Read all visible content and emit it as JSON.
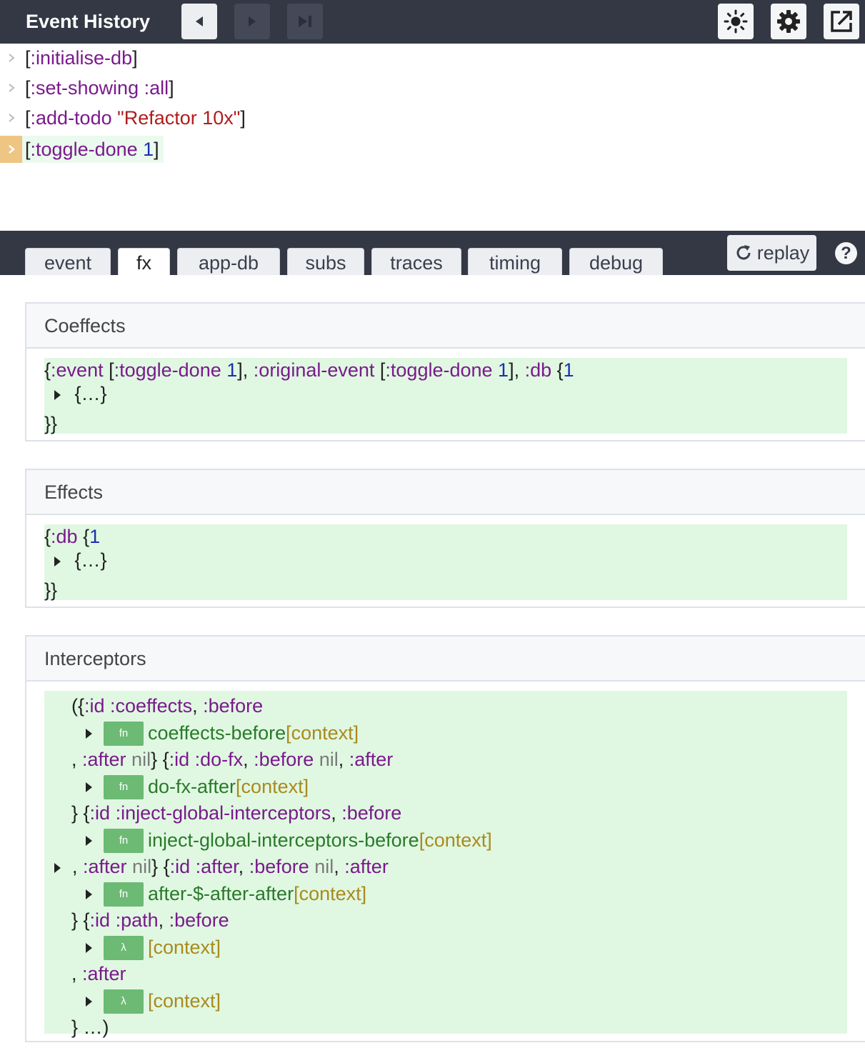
{
  "header": {
    "title": "Event History"
  },
  "events": [
    {
      "parts": [
        {
          "t": "[",
          "c": "p"
        },
        {
          "t": ":initialise-db",
          "c": "kw"
        },
        {
          "t": "]",
          "c": "p"
        }
      ],
      "selected": false
    },
    {
      "parts": [
        {
          "t": "[",
          "c": "p"
        },
        {
          "t": ":set-showing :all",
          "c": "kw"
        },
        {
          "t": "]",
          "c": "p"
        }
      ],
      "selected": false
    },
    {
      "parts": [
        {
          "t": "[",
          "c": "p"
        },
        {
          "t": ":add-todo ",
          "c": "kw"
        },
        {
          "t": "\"Refactor 10x\"",
          "c": "str"
        },
        {
          "t": "]",
          "c": "p"
        }
      ],
      "selected": false
    },
    {
      "parts": [
        {
          "t": "[",
          "c": "p"
        },
        {
          "t": ":toggle-done ",
          "c": "kw"
        },
        {
          "t": "1",
          "c": "num"
        },
        {
          "t": "]",
          "c": "p"
        }
      ],
      "selected": true
    }
  ],
  "tabs": [
    {
      "label": "event",
      "active": false
    },
    {
      "label": "fx",
      "active": true
    },
    {
      "label": "app-db",
      "active": false
    },
    {
      "label": "subs",
      "active": false
    },
    {
      "label": "traces",
      "active": false
    },
    {
      "label": "timing",
      "active": false
    },
    {
      "label": "debug",
      "active": false
    }
  ],
  "replay_label": "replay",
  "help_label": "?",
  "coeffects": {
    "title": "Coeffects",
    "line1": [
      {
        "t": "{",
        "c": "p"
      },
      {
        "t": ":event",
        "c": "kw"
      },
      {
        "t": " [",
        "c": "p"
      },
      {
        "t": ":toggle-done",
        "c": "kw"
      },
      {
        "t": " ",
        "c": "p"
      },
      {
        "t": "1",
        "c": "num"
      },
      {
        "t": "], ",
        "c": "p"
      },
      {
        "t": ":original-event",
        "c": "kw"
      },
      {
        "t": " [",
        "c": "p"
      },
      {
        "t": ":toggle-done",
        "c": "kw"
      },
      {
        "t": " ",
        "c": "p"
      },
      {
        "t": "1",
        "c": "num"
      },
      {
        "t": "], ",
        "c": "p"
      },
      {
        "t": ":db",
        "c": "kw"
      },
      {
        "t": " {",
        "c": "p"
      },
      {
        "t": "1",
        "c": "num"
      }
    ],
    "collapsed": "{…}",
    "closing": "}}"
  },
  "effects": {
    "title": "Effects",
    "line1": [
      {
        "t": "{",
        "c": "p"
      },
      {
        "t": ":db",
        "c": "kw"
      },
      {
        "t": " {",
        "c": "p"
      },
      {
        "t": "1",
        "c": "num"
      }
    ],
    "collapsed": "{…}",
    "closing": "}}"
  },
  "interceptors": {
    "title": "Interceptors",
    "rows": [
      {
        "tri": false,
        "parts": [
          {
            "t": "({",
            "c": "p"
          },
          {
            "t": ":id :coeffects",
            "c": "kw"
          },
          {
            "t": ", ",
            "c": "p"
          },
          {
            "t": ":before",
            "c": "kw"
          }
        ]
      },
      {
        "fn": "fn",
        "name": "coeffects-before",
        "ctx": "[context]"
      },
      {
        "tri": false,
        "parts": [
          {
            "t": ", ",
            "c": "p"
          },
          {
            "t": ":after",
            "c": "kw"
          },
          {
            "t": " nil",
            "c": "nil"
          },
          {
            "t": "} {",
            "c": "p"
          },
          {
            "t": ":id :do-fx",
            "c": "kw"
          },
          {
            "t": ", ",
            "c": "p"
          },
          {
            "t": ":before",
            "c": "kw"
          },
          {
            "t": " nil",
            "c": "nil"
          },
          {
            "t": ", ",
            "c": "p"
          },
          {
            "t": ":after",
            "c": "kw"
          }
        ]
      },
      {
        "fn": "fn",
        "name": "do-fx-after",
        "ctx": "[context]"
      },
      {
        "tri": false,
        "parts": [
          {
            "t": "} {",
            "c": "p"
          },
          {
            "t": ":id :inject-global-interceptors",
            "c": "kw"
          },
          {
            "t": ", ",
            "c": "p"
          },
          {
            "t": ":before",
            "c": "kw"
          }
        ]
      },
      {
        "fn": "fn",
        "name": "inject-global-interceptors-before",
        "ctx": "[context]"
      },
      {
        "tri": true,
        "parts": [
          {
            "t": ", ",
            "c": "p"
          },
          {
            "t": ":after",
            "c": "kw"
          },
          {
            "t": " nil",
            "c": "nil"
          },
          {
            "t": "} {",
            "c": "p"
          },
          {
            "t": ":id :after",
            "c": "kw"
          },
          {
            "t": ", ",
            "c": "p"
          },
          {
            "t": ":before",
            "c": "kw"
          },
          {
            "t": " nil",
            "c": "nil"
          },
          {
            "t": ", ",
            "c": "p"
          },
          {
            "t": ":after",
            "c": "kw"
          }
        ]
      },
      {
        "fn": "fn",
        "name": "after-$-after-after",
        "ctx": "[context]"
      },
      {
        "tri": false,
        "parts": [
          {
            "t": "} {",
            "c": "p"
          },
          {
            "t": ":id :path",
            "c": "kw"
          },
          {
            "t": ", ",
            "c": "p"
          },
          {
            "t": ":before",
            "c": "kw"
          }
        ]
      },
      {
        "fn": "λ",
        "name": "",
        "ctx": "[context]"
      },
      {
        "tri": false,
        "parts": [
          {
            "t": ", ",
            "c": "p"
          },
          {
            "t": ":after",
            "c": "kw"
          }
        ]
      },
      {
        "fn": "λ",
        "name": "",
        "ctx": "[context]"
      },
      {
        "tri": false,
        "parts": [
          {
            "t": "} …)",
            "c": "p"
          }
        ]
      }
    ]
  },
  "colors": {
    "topbar_bg": "#333844",
    "selected_arrow_bg": "#eec582",
    "code_bg": "#e0f8e2",
    "fn_badge": "#6cba74",
    "keyword": "#7a1a8c",
    "number": "#1c2fb0",
    "string": "#b11d1d"
  },
  "icons": {
    "back": "chevron-left-icon",
    "forward": "chevron-right-icon",
    "end": "skip-to-end-icon",
    "theme": "sun-icon",
    "settings": "gear-icon",
    "popout": "external-link-icon",
    "replay": "refresh-icon",
    "help": "question-icon"
  }
}
